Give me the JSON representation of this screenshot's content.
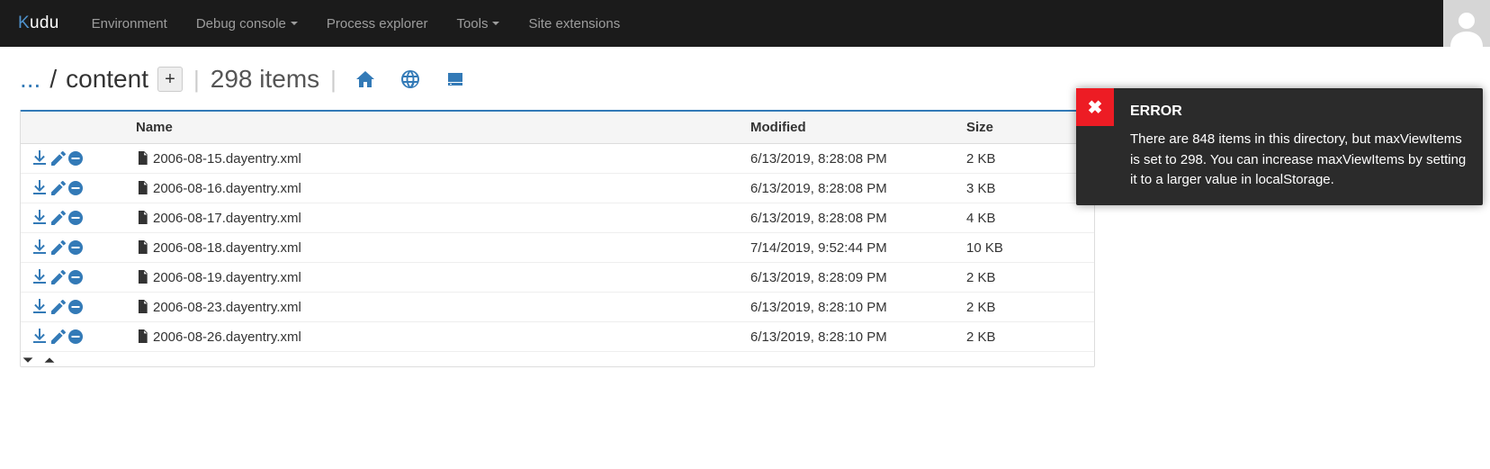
{
  "nav": {
    "brand_k": "K",
    "brand_rest": "udu",
    "items": [
      {
        "label": "Environment",
        "caret": false
      },
      {
        "label": "Debug console",
        "caret": true
      },
      {
        "label": "Process explorer",
        "caret": false
      },
      {
        "label": "Tools",
        "caret": true
      },
      {
        "label": "Site extensions",
        "caret": false
      }
    ]
  },
  "breadcrumb": {
    "prefix": "...",
    "current": "content",
    "item_count": "298 items"
  },
  "table": {
    "headers": {
      "name": "Name",
      "modified": "Modified",
      "size": "Size"
    },
    "rows": [
      {
        "name": "2006-08-15.dayentry.xml",
        "modified": "6/13/2019, 8:28:08 PM",
        "size": "2 KB"
      },
      {
        "name": "2006-08-16.dayentry.xml",
        "modified": "6/13/2019, 8:28:08 PM",
        "size": "3 KB"
      },
      {
        "name": "2006-08-17.dayentry.xml",
        "modified": "6/13/2019, 8:28:08 PM",
        "size": "4 KB"
      },
      {
        "name": "2006-08-18.dayentry.xml",
        "modified": "7/14/2019, 9:52:44 PM",
        "size": "10 KB"
      },
      {
        "name": "2006-08-19.dayentry.xml",
        "modified": "6/13/2019, 8:28:09 PM",
        "size": "2 KB"
      },
      {
        "name": "2006-08-23.dayentry.xml",
        "modified": "6/13/2019, 8:28:10 PM",
        "size": "2 KB"
      },
      {
        "name": "2006-08-26.dayentry.xml",
        "modified": "6/13/2019, 8:28:10 PM",
        "size": "2 KB"
      }
    ]
  },
  "toast": {
    "title": "ERROR",
    "message": "There are 848 items in this directory, but maxViewItems is set to 298. You can increase maxViewItems by setting it to a larger value in localStorage."
  }
}
